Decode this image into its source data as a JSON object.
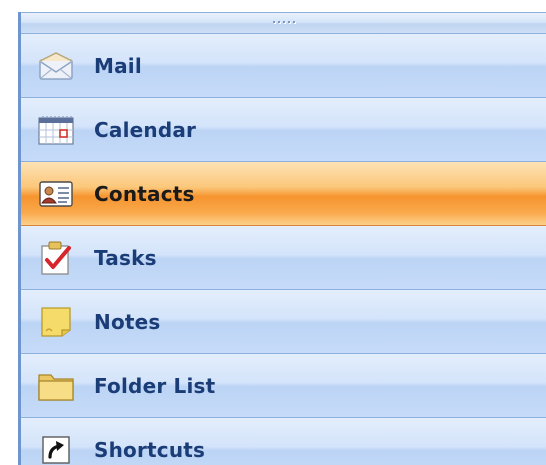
{
  "navigation_pane": {
    "items": [
      {
        "label": "Mail",
        "icon": "envelope-icon",
        "selected": false
      },
      {
        "label": "Calendar",
        "icon": "calendar-icon",
        "selected": false
      },
      {
        "label": "Contacts",
        "icon": "contact-card-icon",
        "selected": true
      },
      {
        "label": "Tasks",
        "icon": "task-checklist-icon",
        "selected": false
      },
      {
        "label": "Notes",
        "icon": "sticky-note-icon",
        "selected": false
      },
      {
        "label": "Folder List",
        "icon": "folder-icon",
        "selected": false
      },
      {
        "label": "Shortcuts",
        "icon": "shortcut-arrow-icon",
        "selected": false
      }
    ]
  },
  "colors": {
    "item_text": "#1b3d77",
    "selected_highlight": "#f6942f",
    "pane_background": "#cfe0f7"
  }
}
